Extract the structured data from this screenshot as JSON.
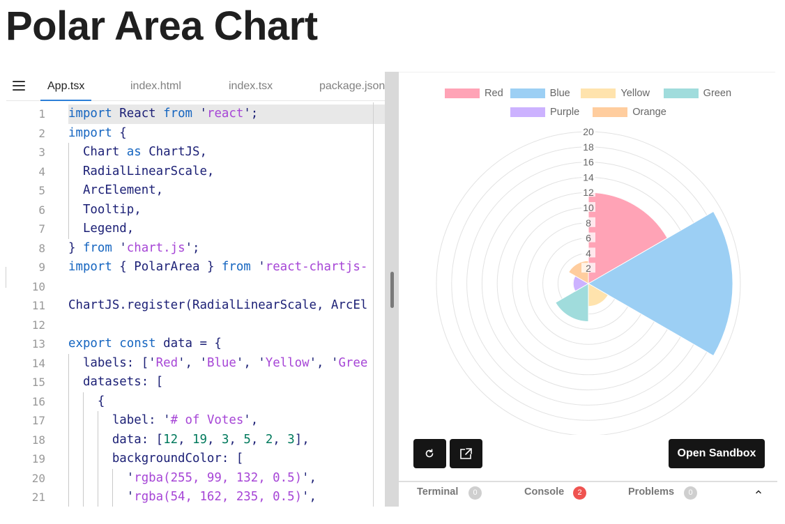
{
  "page": {
    "title": "Polar Area Chart"
  },
  "editor": {
    "tabs": [
      {
        "label": "App.tsx",
        "active": true
      },
      {
        "label": "index.html",
        "active": false
      },
      {
        "label": "index.tsx",
        "active": false
      },
      {
        "label": "package.json",
        "active": false
      }
    ],
    "lines": [
      {
        "n": "1",
        "tokens": [
          [
            "k",
            "import"
          ],
          [
            "p",
            " React "
          ],
          [
            "k",
            "from"
          ],
          [
            "p",
            " '"
          ],
          [
            "s",
            "react"
          ],
          [
            "p",
            "';"
          ]
        ]
      },
      {
        "n": "2",
        "tokens": [
          [
            "k",
            "import"
          ],
          [
            "p",
            " {"
          ]
        ]
      },
      {
        "n": "3",
        "tokens": [
          [
            "p",
            "  Chart "
          ],
          [
            "k",
            "as"
          ],
          [
            "p",
            " ChartJS,"
          ]
        ]
      },
      {
        "n": "4",
        "tokens": [
          [
            "p",
            "  RadialLinearScale,"
          ]
        ]
      },
      {
        "n": "5",
        "tokens": [
          [
            "p",
            "  ArcElement,"
          ]
        ]
      },
      {
        "n": "6",
        "tokens": [
          [
            "p",
            "  Tooltip,"
          ]
        ]
      },
      {
        "n": "7",
        "tokens": [
          [
            "p",
            "  Legend,"
          ]
        ]
      },
      {
        "n": "8",
        "tokens": [
          [
            "p",
            "} "
          ],
          [
            "k",
            "from"
          ],
          [
            "p",
            " '"
          ],
          [
            "s",
            "chart.js"
          ],
          [
            "p",
            "';"
          ]
        ]
      },
      {
        "n": "9",
        "tokens": [
          [
            "k",
            "import"
          ],
          [
            "p",
            " { PolarArea } "
          ],
          [
            "k",
            "from"
          ],
          [
            "p",
            " '"
          ],
          [
            "s",
            "react-chartjs-"
          ]
        ]
      },
      {
        "n": "10",
        "tokens": []
      },
      {
        "n": "11",
        "tokens": [
          [
            "p",
            "ChartJS.register(RadialLinearScale, ArcEl"
          ]
        ]
      },
      {
        "n": "12",
        "tokens": []
      },
      {
        "n": "13",
        "tokens": [
          [
            "k",
            "export const"
          ],
          [
            "p",
            " data = {"
          ]
        ]
      },
      {
        "n": "14",
        "tokens": [
          [
            "p",
            "  labels: ['"
          ],
          [
            "s",
            "Red"
          ],
          [
            "p",
            "', '"
          ],
          [
            "s",
            "Blue"
          ],
          [
            "p",
            "', '"
          ],
          [
            "s",
            "Yellow"
          ],
          [
            "p",
            "', '"
          ],
          [
            "s",
            "Gree"
          ]
        ]
      },
      {
        "n": "15",
        "tokens": [
          [
            "p",
            "  datasets: ["
          ]
        ]
      },
      {
        "n": "16",
        "tokens": [
          [
            "p",
            "    {"
          ]
        ]
      },
      {
        "n": "17",
        "tokens": [
          [
            "p",
            "      label: '"
          ],
          [
            "s",
            "# of Votes"
          ],
          [
            "p",
            "',"
          ]
        ]
      },
      {
        "n": "18",
        "tokens": [
          [
            "p",
            "      data: ["
          ],
          [
            "n",
            "12"
          ],
          [
            "p",
            ", "
          ],
          [
            "n",
            "19"
          ],
          [
            "p",
            ", "
          ],
          [
            "n",
            "3"
          ],
          [
            "p",
            ", "
          ],
          [
            "n",
            "5"
          ],
          [
            "p",
            ", "
          ],
          [
            "n",
            "2"
          ],
          [
            "p",
            ", "
          ],
          [
            "n",
            "3"
          ],
          [
            "p",
            "],"
          ]
        ]
      },
      {
        "n": "19",
        "tokens": [
          [
            "p",
            "      backgroundColor: ["
          ]
        ]
      },
      {
        "n": "20",
        "tokens": [
          [
            "p",
            "        '"
          ],
          [
            "s",
            "rgba(255, 99, 132, 0.5)"
          ],
          [
            "p",
            "',"
          ]
        ]
      },
      {
        "n": "21",
        "tokens": [
          [
            "p",
            "        '"
          ],
          [
            "s",
            "rgba(54, 162, 235, 0.5)"
          ],
          [
            "p",
            "',"
          ]
        ]
      }
    ]
  },
  "chart_data": {
    "type": "polarArea",
    "categories": [
      "Red",
      "Blue",
      "Yellow",
      "Green",
      "Purple",
      "Orange"
    ],
    "values": [
      12,
      19,
      3,
      5,
      2,
      3
    ],
    "colors": [
      "#ffa3b6",
      "#9ccff4",
      "#ffe3ad",
      "#a0dcdc",
      "#ccb2ff",
      "#ffcd9e"
    ],
    "ticks": [
      "20",
      "18",
      "16",
      "14",
      "12",
      "10",
      "8",
      "6",
      "4",
      "2"
    ],
    "rlim": [
      0,
      20
    ],
    "legend_position": "top"
  },
  "preview": {
    "open_sandbox_label": "Open Sandbox"
  },
  "bottom": {
    "tabs": [
      {
        "label": "Terminal",
        "count": "0",
        "alert": false
      },
      {
        "label": "Console",
        "count": "2",
        "alert": true
      },
      {
        "label": "Problems",
        "count": "0",
        "alert": false
      }
    ]
  }
}
